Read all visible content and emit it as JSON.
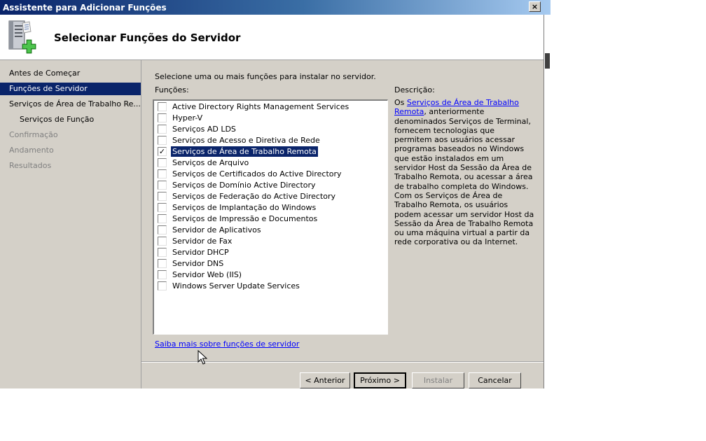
{
  "window": {
    "title": "Assistente para Adicionar Funções",
    "close_label": "×"
  },
  "header": {
    "title": "Selecionar Funções do Servidor",
    "icon": "server-add-icon"
  },
  "nav": {
    "items": [
      {
        "label": "Antes de Começar",
        "state": "normal"
      },
      {
        "label": "Funções de Servidor",
        "state": "selected"
      },
      {
        "label": "Serviços de Área de Trabalho Re...",
        "state": "normal"
      },
      {
        "label": "Serviços de Função",
        "state": "sub"
      },
      {
        "label": "Confirmação",
        "state": "disabled"
      },
      {
        "label": "Andamento",
        "state": "disabled"
      },
      {
        "label": "Resultados",
        "state": "disabled"
      }
    ]
  },
  "main": {
    "instruction": "Selecione uma ou mais funções para instalar no servidor.",
    "roles_label": "Funções:",
    "roles": [
      {
        "label": "Active Directory Rights Management Services",
        "checked": false
      },
      {
        "label": "Hyper-V",
        "checked": false
      },
      {
        "label": "Serviços AD LDS",
        "checked": false
      },
      {
        "label": "Serviços de Acesso e Diretiva de Rede",
        "checked": false
      },
      {
        "label": "Serviços de Área de Trabalho Remota",
        "checked": true
      },
      {
        "label": "Serviços de Arquivo",
        "checked": false
      },
      {
        "label": "Serviços de Certificados do Active Directory",
        "checked": false
      },
      {
        "label": "Serviços de Domínio Active Directory",
        "checked": false
      },
      {
        "label": "Serviços de Federação do Active Directory",
        "checked": false
      },
      {
        "label": "Serviços de Implantação do Windows",
        "checked": false
      },
      {
        "label": "Serviços de Impressão e Documentos",
        "checked": false
      },
      {
        "label": "Servidor de Aplicativos",
        "checked": false
      },
      {
        "label": "Servidor de Fax",
        "checked": false
      },
      {
        "label": "Servidor DHCP",
        "checked": false
      },
      {
        "label": "Servidor DNS",
        "checked": false
      },
      {
        "label": "Servidor Web (IIS)",
        "checked": false
      },
      {
        "label": "Windows Server Update Services",
        "checked": false
      }
    ],
    "description_label": "Descrição:",
    "description": {
      "prefix": "Os ",
      "link": "Serviços de Área de Trabalho Remota",
      "suffix": ", anteriormente denominados Serviços de Terminal, fornecem tecnologias que permitem aos usuários acessar programas baseados no Windows que estão instalados em um servidor Host da Sessão da Área de Trabalho Remota, ou acessar a área de trabalho completa do Windows. Com os Serviços de Área de Trabalho Remota, os usuários podem acessar um servidor Host da Sessão da Área de Trabalho Remota ou uma máquina virtual a partir da rede corporativa ou da Internet."
    },
    "more_link": "Saiba mais sobre funções de servidor"
  },
  "buttons": {
    "back": "< Anterior",
    "next": "Próximo >",
    "install": "Instalar",
    "cancel": "Cancelar"
  },
  "check_mark": "✓",
  "colors": {
    "selection": "#0a246a",
    "face": "#d4d0c8",
    "link": "#0000ff"
  }
}
